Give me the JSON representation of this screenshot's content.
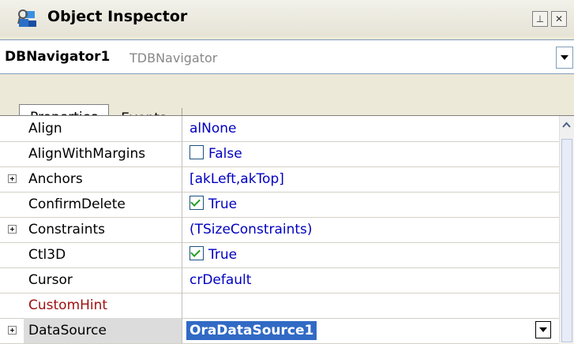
{
  "window": {
    "title": "Object Inspector",
    "pin_icon": "pin-icon",
    "close_icon": "close-icon"
  },
  "component": {
    "name": "DBNavigator1",
    "type": "TDBNavigator"
  },
  "tabs": [
    {
      "label": "Properties",
      "active": true
    },
    {
      "label": "Events",
      "active": false
    }
  ],
  "properties": [
    {
      "name": "Align",
      "value": "alNone",
      "expandable": false
    },
    {
      "name": "AlignWithMargins",
      "value": "False",
      "checkbox": true,
      "checked": false,
      "expandable": false
    },
    {
      "name": "Anchors",
      "value": "[akLeft,akTop]",
      "expandable": true
    },
    {
      "name": "ConfirmDelete",
      "value": "True",
      "checkbox": true,
      "checked": true,
      "expandable": false
    },
    {
      "name": "Constraints",
      "value": "(TSizeConstraints)",
      "expandable": true
    },
    {
      "name": "Ctl3D",
      "value": "True",
      "checkbox": true,
      "checked": true,
      "expandable": false
    },
    {
      "name": "Cursor",
      "value": "crDefault",
      "expandable": false
    },
    {
      "name": "CustomHint",
      "value": "",
      "expandable": false,
      "highlight_color": "#a01010"
    },
    {
      "name": "DataSource",
      "value": "OraDataSource1",
      "expandable": true,
      "selected": true
    }
  ],
  "colors": {
    "value_text": "#0000c0",
    "selection": "#316ac5",
    "checkmark": "#21a121"
  }
}
